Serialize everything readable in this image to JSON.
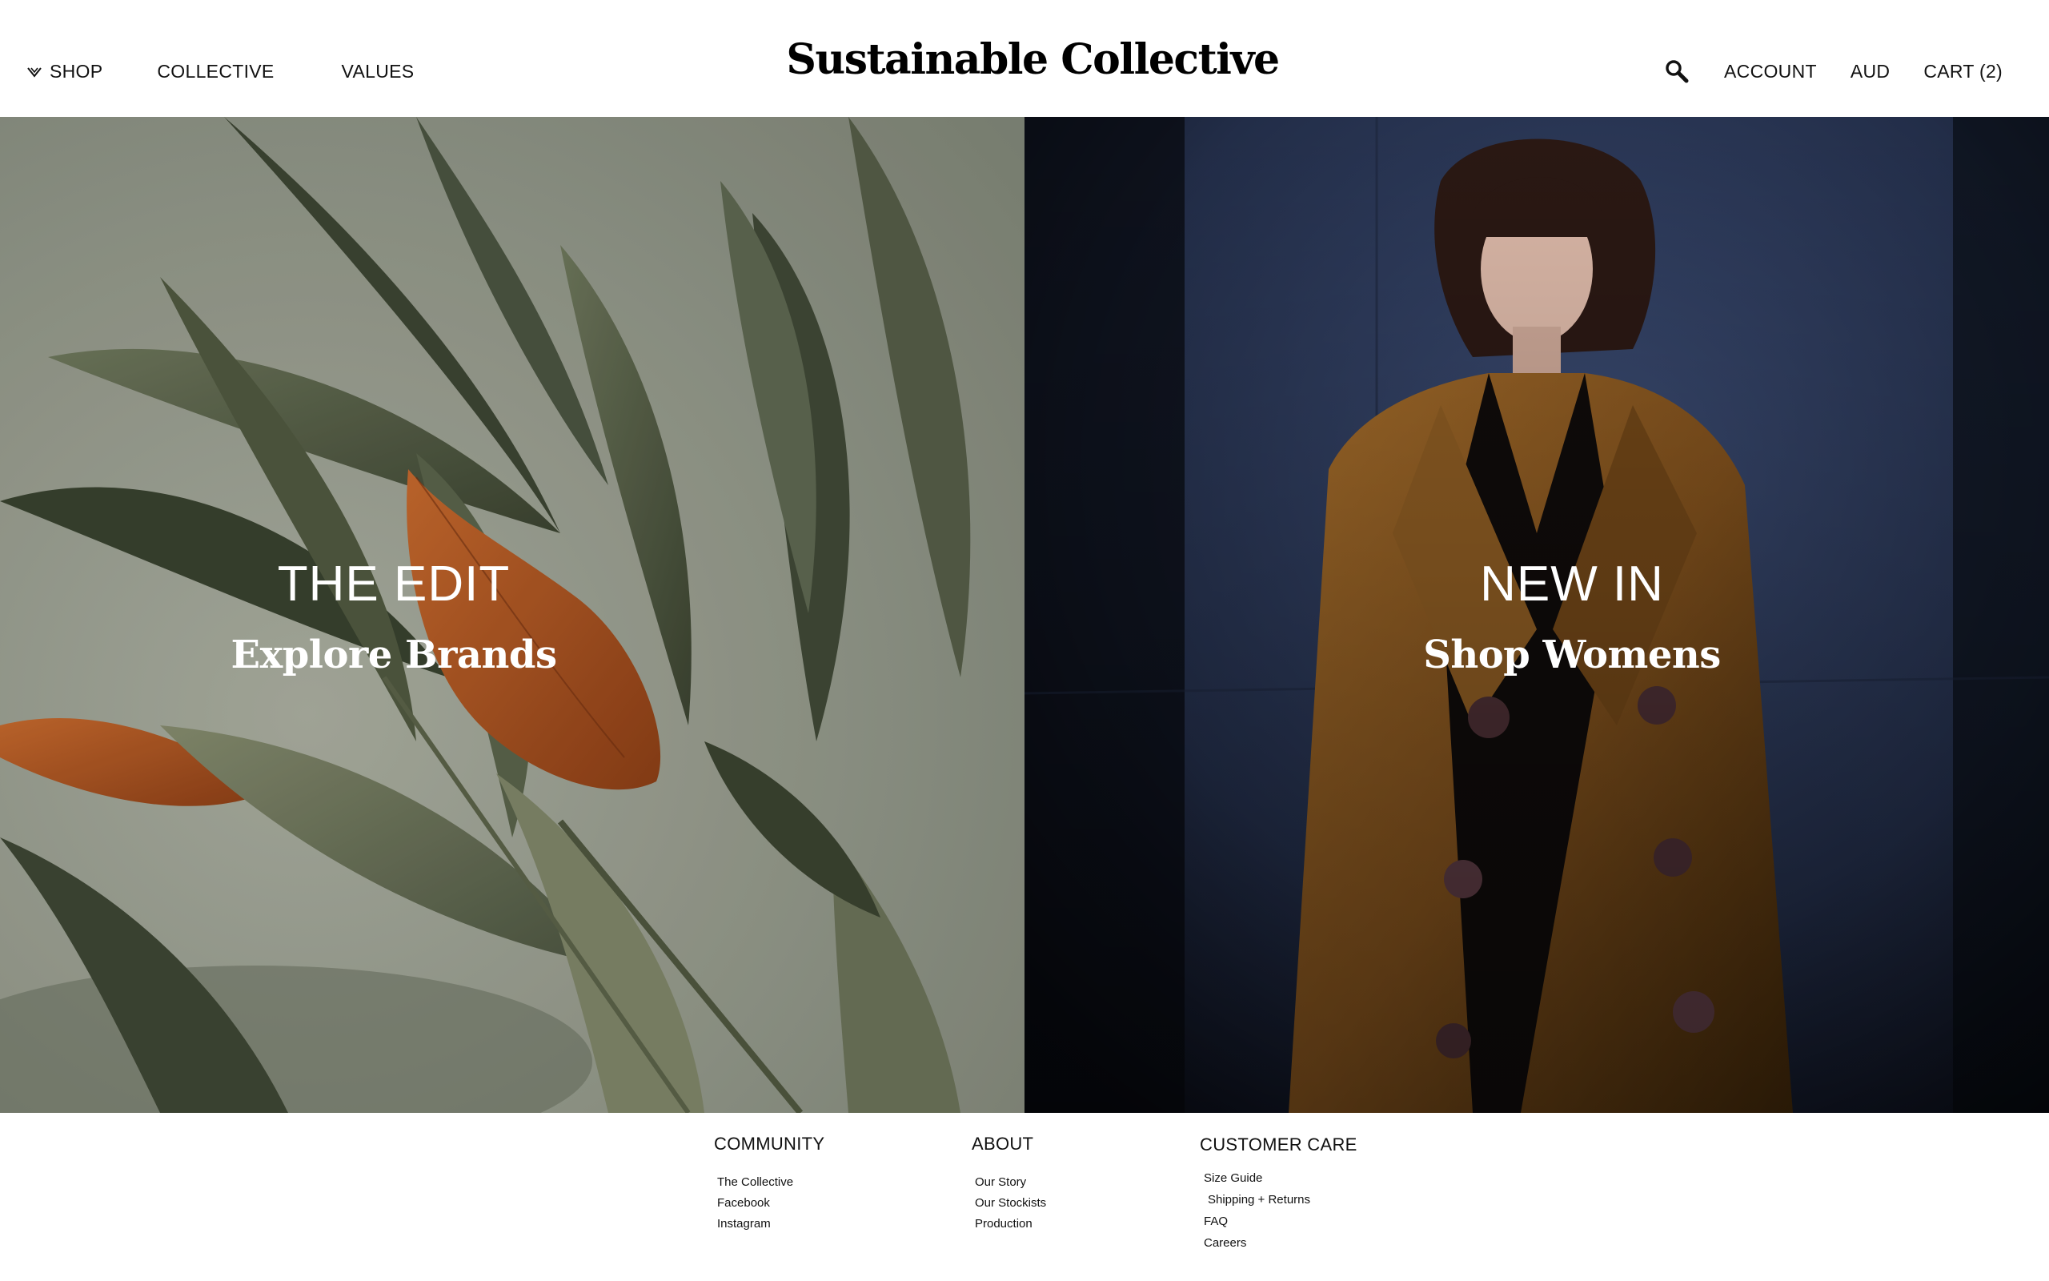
{
  "brand": {
    "name": "Sustainable Collective"
  },
  "nav": {
    "left": [
      {
        "label": "SHOP",
        "icon": "chevron-down-icon"
      },
      {
        "label": "COLLECTIVE"
      },
      {
        "label": "VALUES"
      }
    ],
    "right": {
      "search_icon": "search-icon",
      "account": "ACCOUNT",
      "currency": "AUD",
      "cart": "CART (2)"
    }
  },
  "hero": {
    "left": {
      "title": "THE EDIT",
      "subtitle": "Explore Brands"
    },
    "right": {
      "title": "NEW IN",
      "subtitle": "Shop Womens"
    }
  },
  "footer": {
    "community": {
      "heading": "COMMUNITY",
      "links": [
        "The Collective",
        "Facebook",
        "Instagram"
      ]
    },
    "about": {
      "heading": "ABOUT",
      "links": [
        "Our Story",
        "Our Stockists",
        "Production"
      ]
    },
    "customer_care": {
      "heading": "CUSTOMER CARE",
      "links": [
        "Size Guide",
        "Shipping + Returns",
        "FAQ",
        "Careers"
      ]
    }
  }
}
